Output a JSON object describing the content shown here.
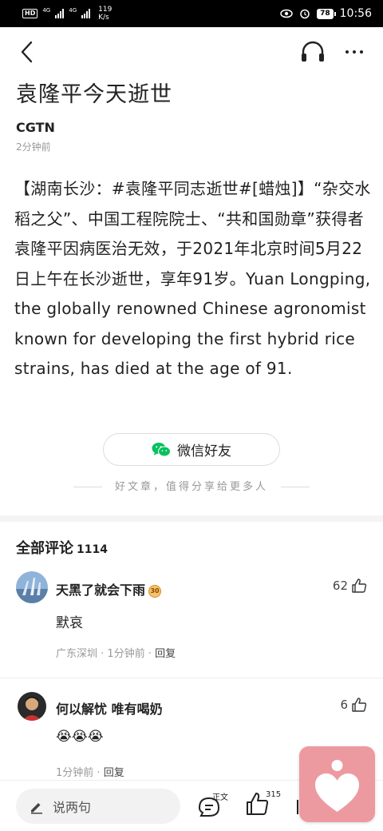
{
  "status_bar": {
    "hd": "HD",
    "net1": "4G",
    "net2": "4G",
    "speed_value": "119",
    "speed_unit": "K/s",
    "battery": "78",
    "time": "10:56"
  },
  "article": {
    "title": "袁隆平今天逝世",
    "source": "CGTN",
    "time": "2分钟前",
    "body": "【湖南长沙：#袁隆平同志逝世#[蜡烛]】“杂交水稻之父”、中国工程院院士、“共和国勋章”获得者袁隆平因病医治无效，于2021年北京时间5月22日上午在长沙逝世，享年91岁。Yuan Longping, the globally renowned Chinese agronomist known for developing the first hybrid rice strains, has died at the age of 91."
  },
  "share": {
    "button_label": "微信好友",
    "tip": "好文章，值得分享给更多人"
  },
  "comments": {
    "header": "全部评论",
    "count": "1114",
    "items": [
      {
        "user": "天黑了就会下雨",
        "badge": "30",
        "likes": "62",
        "text": "默哀",
        "location": "广东深圳",
        "time": "1分钟前",
        "reply": "回复"
      },
      {
        "user": "何以解忧 唯有喝奶",
        "likes": "6",
        "text": "😭😭😭",
        "time": "1分钟前",
        "reply": "回复"
      }
    ]
  },
  "bottom_bar": {
    "input_placeholder": "说两句",
    "comment_label": "正文",
    "like_count": "315"
  },
  "colors": {
    "heart_widget": "#ec9aa0",
    "wechat_green": "#07c160"
  }
}
